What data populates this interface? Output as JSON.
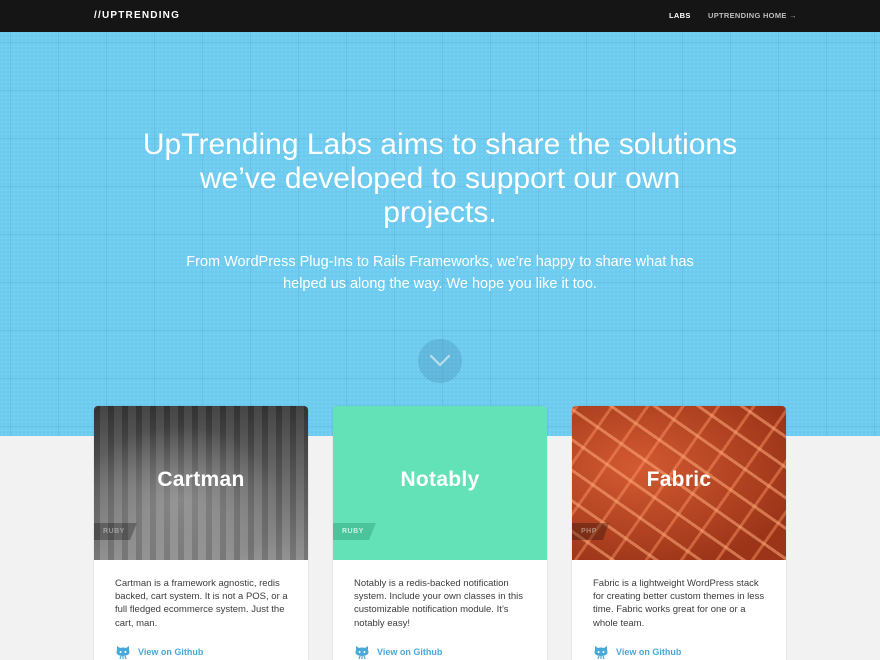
{
  "navbar": {
    "logo": "//UPTRENDING",
    "links": [
      {
        "label": "LABS"
      },
      {
        "label": "UPTRENDING HOME →"
      }
    ]
  },
  "hero": {
    "headline": "UpTrending Labs aims to share the solutions we’ve developed to support our own projects.",
    "intro": "From WordPress Plug-Ins to Rails Frameworks, we’re happy to share what has helped us along the way. We hope you like it too.",
    "scroll_icon": "chevron-down-circle-icon"
  },
  "projects": [
    {
      "title": "Cartman",
      "tag": "RUBY",
      "description": "Cartman is a framework agnostic, redis backed, cart system. It is not a POS, or a full fledged ecommerce system. Just the cart, man.",
      "link_label": "View on Github",
      "link_icon": "github-octocat-icon",
      "image": "blurred-street-photo"
    },
    {
      "title": "Notably",
      "tag": "RUBY",
      "description": "Notably is a redis-backed notification system. Include your own classes in this customizable notification module. It’s notably easy!",
      "link_label": "View on Github",
      "link_icon": "github-octocat-icon",
      "image": "solid-mint-background"
    },
    {
      "title": "Fabric",
      "tag": "PHP",
      "description": "Fabric is a lightweight WordPress stack for creating better custom themes in less time. Fabric works great for one or a whole team.",
      "link_label": "View on Github",
      "link_icon": "github-octocat-icon",
      "image": "orange-fabric-texture"
    }
  ],
  "colors": {
    "navbar_bg": "#151515",
    "hero_bg": "#6ccbef",
    "page_bg": "#f2f2f2",
    "notably_bg": "#63e2b7",
    "fabric_bg": "#c04a25",
    "link": "#4aa9d9"
  }
}
